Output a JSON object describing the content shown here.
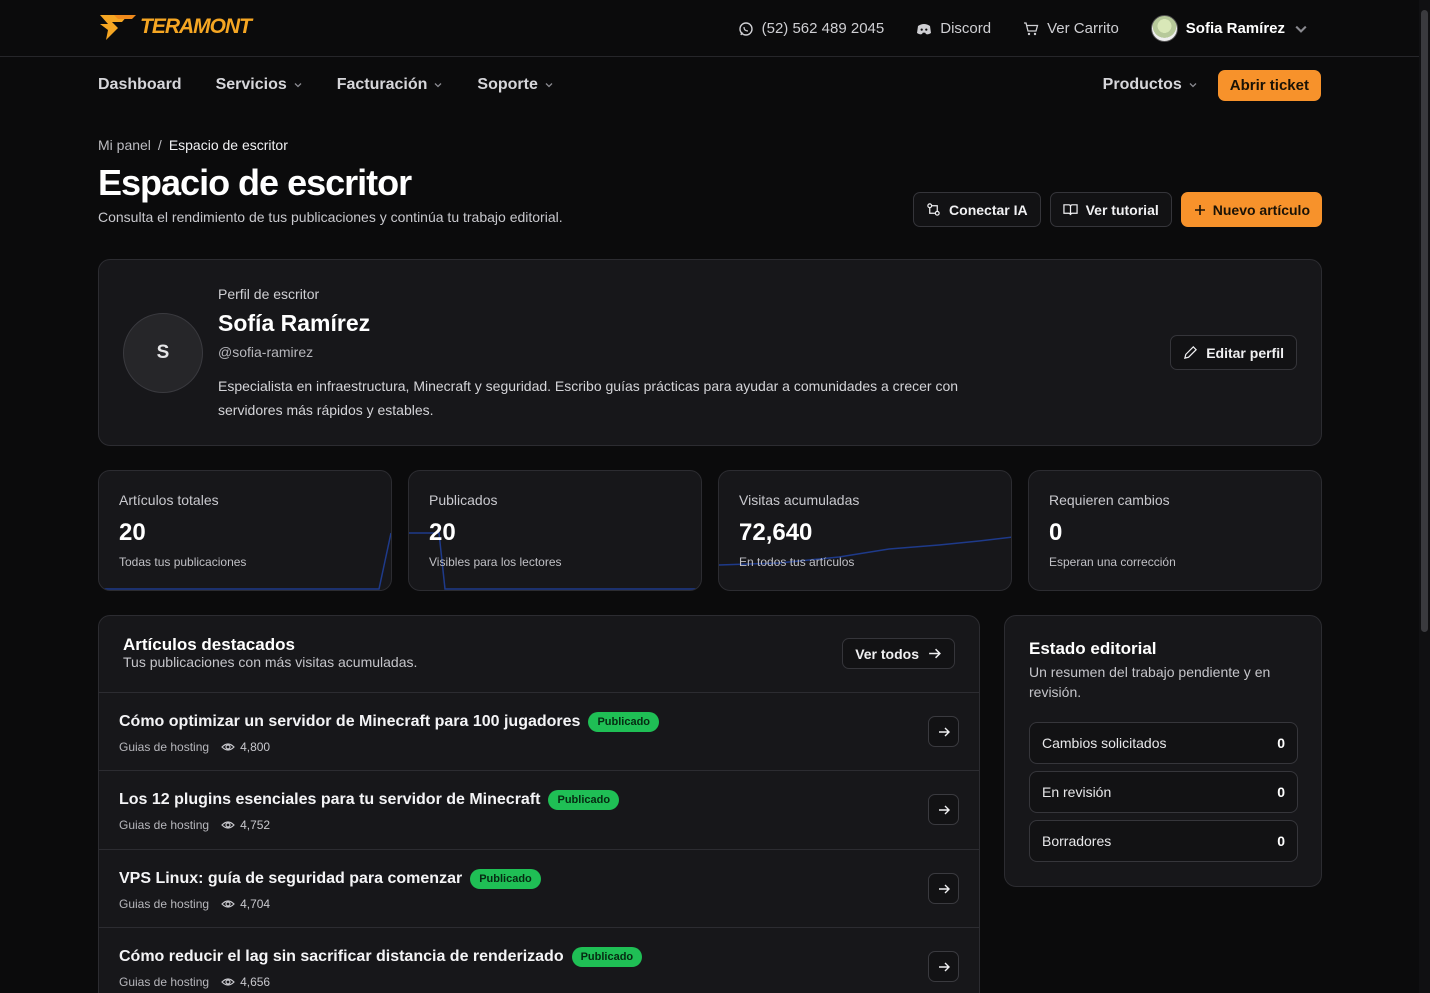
{
  "topbar": {
    "brand": "TERAMONT",
    "phone": "(52) 562 489 2045",
    "discord": "Discord",
    "cart": "Ver Carrito",
    "user_name": "Sofia Ramírez"
  },
  "nav": {
    "items": [
      {
        "label": "Dashboard",
        "has_menu": false
      },
      {
        "label": "Servicios",
        "has_menu": true
      },
      {
        "label": "Facturación",
        "has_menu": true
      },
      {
        "label": "Soporte",
        "has_menu": true
      }
    ],
    "products": "Productos",
    "open_ticket": "Abrir ticket"
  },
  "breadcrumb": {
    "root": "Mi panel",
    "separator": "/",
    "current": "Espacio de escritor"
  },
  "page": {
    "title": "Espacio de escritor",
    "subtitle": "Consulta el rendimiento de tus publicaciones y continúa tu trabajo editorial.",
    "actions": {
      "connect_ai": "Conectar IA",
      "tutorial": "Ver tutorial",
      "new_article": "Nuevo artículo"
    }
  },
  "profile": {
    "kicker": "Perfil de escritor",
    "initial": "S",
    "name": "Sofía Ramírez",
    "handle": "@sofia-ramirez",
    "bio": "Especialista en infraestructura, Minecraft y seguridad. Escribo guías prácticas para ayudar a comunidades a crecer con servidores más rápidos y estables.",
    "edit": "Editar perfil"
  },
  "stats": [
    {
      "label": "Artículos totales",
      "value": "20",
      "sub": "Todas tus publicaciones"
    },
    {
      "label": "Publicados",
      "value": "20",
      "sub": "Visibles para los lectores"
    },
    {
      "label": "Visitas acumuladas",
      "value": "72,640",
      "sub": "En todos tus artículos"
    },
    {
      "label": "Requieren cambios",
      "value": "0",
      "sub": "Esperan una corrección"
    }
  ],
  "featured": {
    "title": "Artículos destacados",
    "subtitle": "Tus publicaciones con más visitas acumuladas.",
    "see_all": "Ver todos",
    "articles": [
      {
        "title": "Cómo optimizar un servidor de Minecraft para 100 jugadores",
        "status": "Publicado",
        "category": "Guias de hosting",
        "views": "4,800"
      },
      {
        "title": "Los 12 plugins esenciales para tu servidor de Minecraft",
        "status": "Publicado",
        "category": "Guias de hosting",
        "views": "4,752"
      },
      {
        "title": "VPS Linux: guía de seguridad para comenzar",
        "status": "Publicado",
        "category": "Guias de hosting",
        "views": "4,704"
      },
      {
        "title": "Cómo reducir el lag sin sacrificar distancia de renderizado",
        "status": "Publicado",
        "category": "Guias de hosting",
        "views": "4,656"
      }
    ]
  },
  "editorial": {
    "title": "Estado editorial",
    "subtitle": "Un resumen del trabajo pendiente y en revisión.",
    "items": [
      {
        "label": "Cambios solicitados",
        "value": "0"
      },
      {
        "label": "En revisión",
        "value": "0"
      },
      {
        "label": "Borradores",
        "value": "0"
      }
    ]
  },
  "colors": {
    "accent": "#f7922b",
    "badge": "#1fbf55",
    "spark": "#1e3a8a"
  }
}
